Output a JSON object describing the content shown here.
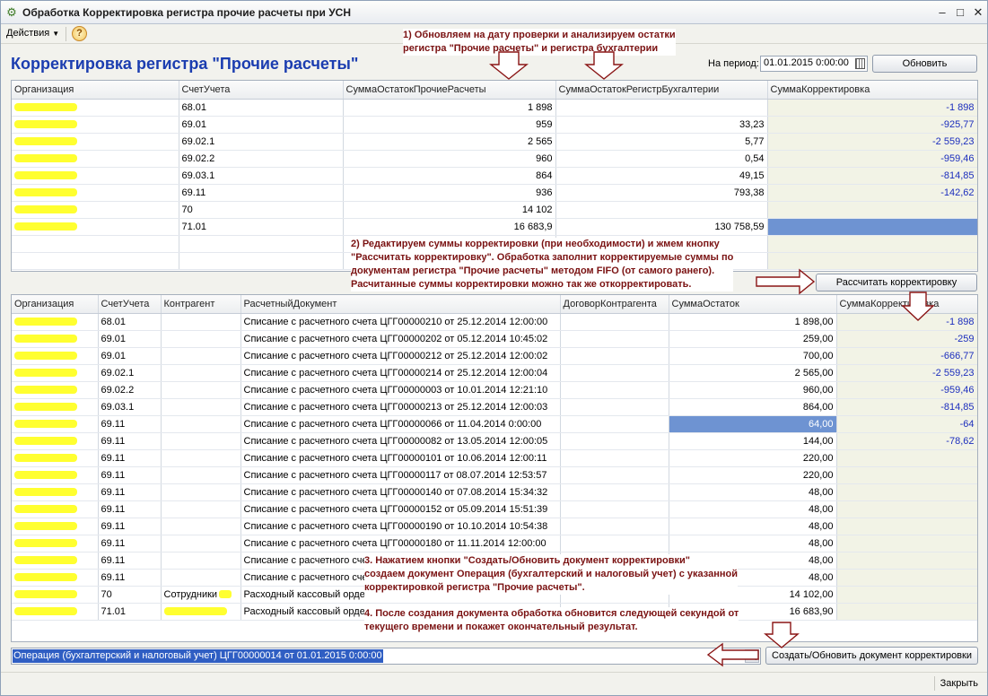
{
  "window": {
    "title": "Обработка  Корректировка регистра прочие расчеты при УСН"
  },
  "toolbar": {
    "actions_label": "Действия",
    "help_label": "?"
  },
  "heading": "Корректировка регистра \"Прочие расчеты\"",
  "period": {
    "label": "На период:",
    "value": "01.01.2015 0:00:00",
    "refresh_label": "Обновить"
  },
  "top_table": {
    "headers": [
      "Организация",
      "СчетУчета",
      "СуммаОстатокПрочиеРасчеты",
      "СуммаОстатокРегистрБухгалтерии",
      "СуммаКорректировка"
    ],
    "rows": [
      [
        "68.01",
        "1 898",
        "",
        "-1 898"
      ],
      [
        "69.01",
        "959",
        "33,23",
        "-925,77"
      ],
      [
        "69.02.1",
        "2 565",
        "5,77",
        "-2 559,23"
      ],
      [
        "69.02.2",
        "960",
        "0,54",
        "-959,46"
      ],
      [
        "69.03.1",
        "864",
        "49,15",
        "-814,85"
      ],
      [
        "69.11",
        "936",
        "793,38",
        "-142,62"
      ],
      [
        "70",
        "14 102",
        "",
        ""
      ],
      [
        "71.01",
        "16 683,9",
        "130 758,59",
        ""
      ]
    ]
  },
  "calc_button_label": "Рассчитать корректировку",
  "bottom_table": {
    "headers": [
      "Организация",
      "СчетУчета",
      "Контрагент",
      "РасчетныйДокумент",
      "ДоговорКонтрагента",
      "СуммаОстаток",
      "СуммаКорректировка"
    ],
    "rows": [
      [
        "68.01",
        "",
        "Списание с расчетного счета ЦГГ00000210 от 25.12.2014 12:00:00",
        "",
        "1 898,00",
        "-1 898"
      ],
      [
        "69.01",
        "",
        "Списание с расчетного счета ЦГГ00000202 от 05.12.2014 10:45:02",
        "",
        "259,00",
        "-259"
      ],
      [
        "69.01",
        "",
        "Списание с расчетного счета ЦГГ00000212 от 25.12.2014 12:00:02",
        "",
        "700,00",
        "-666,77"
      ],
      [
        "69.02.1",
        "",
        "Списание с расчетного счета ЦГГ00000214 от 25.12.2014 12:00:04",
        "",
        "2 565,00",
        "-2 559,23"
      ],
      [
        "69.02.2",
        "",
        "Списание с расчетного счета ЦГГ00000003 от 10.01.2014 12:21:10",
        "",
        "960,00",
        "-959,46"
      ],
      [
        "69.03.1",
        "",
        "Списание с расчетного счета ЦГГ00000213 от 25.12.2014 12:00:03",
        "",
        "864,00",
        "-814,85"
      ],
      [
        "69.11",
        "",
        "Списание с расчетного счета ЦГГ00000066 от 11.04.2014 0:00:00",
        "",
        "64,00",
        "-64"
      ],
      [
        "69.11",
        "",
        "Списание с расчетного счета ЦГГ00000082 от 13.05.2014 12:00:05",
        "",
        "144,00",
        "-78,62"
      ],
      [
        "69.11",
        "",
        "Списание с расчетного счета ЦГГ00000101 от 10.06.2014 12:00:11",
        "",
        "220,00",
        ""
      ],
      [
        "69.11",
        "",
        "Списание с расчетного счета ЦГГ00000117 от 08.07.2014 12:53:57",
        "",
        "220,00",
        ""
      ],
      [
        "69.11",
        "",
        "Списание с расчетного счета ЦГГ00000140 от 07.08.2014 15:34:32",
        "",
        "48,00",
        ""
      ],
      [
        "69.11",
        "",
        "Списание с расчетного счета ЦГГ00000152 от 05.09.2014 15:51:39",
        "",
        "48,00",
        ""
      ],
      [
        "69.11",
        "",
        "Списание с расчетного счета ЦГГ00000190 от 10.10.2014 10:54:38",
        "",
        "48,00",
        ""
      ],
      [
        "69.11",
        "",
        "Списание с расчетного счета ЦГГ00000180 от 11.11.2014 12:00:00",
        "",
        "48,00",
        ""
      ],
      [
        "69.11",
        "",
        "Списание с расчетного сче",
        "",
        "48,00",
        ""
      ],
      [
        "69.11",
        "",
        "Списание с расчетного сче",
        "",
        "48,00",
        ""
      ],
      [
        "70",
        "Сотрудники",
        "Расходный кассовый орде",
        "",
        "14 102,00",
        ""
      ],
      [
        "71.01",
        "",
        "Расходный кассовый орде",
        "",
        "16 683,90",
        ""
      ]
    ]
  },
  "notes": {
    "n1": "1) Обновляем на дату проверки и анализируем остатки\nрегистра \"Прочие расчеты\" и регистра бухгалтерии",
    "n2": "2) Редактируем суммы корректировки (при необходимости) и жмем кнопку\n\"Рассчитать корректировку\". Обработка заполнит корректируемые суммы по\nдокументам регистра \"Прочие расчеты\" методом FIFO (от самого ранего).\nРасчитанные суммы корректировки можно так же откорректировать.",
    "n3": "3. Нажатием кнопки \"Создать/Обновить документ корректировки\"\nсоздаем документ Операция (бухгалтерский и налоговый учет) с указанной\nкорректировкой регистра \"Прочие расчеты\".",
    "n4": "4. После создания документа обработка обновится следующей секундой от\nтекущего времени и покажет окончательный результат."
  },
  "document_field": {
    "value": "Операция (бухгалтерский и налоговый учет) ЦГГ00000014 от 01.01.2015 0:00:00"
  },
  "create_button_label": "Создать/Обновить документ корректировки",
  "close_label": "Закрыть",
  "colors": {
    "heading": "#1b3db0",
    "note": "#7a1212",
    "correction_text": "#1c2ebd",
    "selection": "#6e93d2",
    "redaction": "#ffff30"
  }
}
